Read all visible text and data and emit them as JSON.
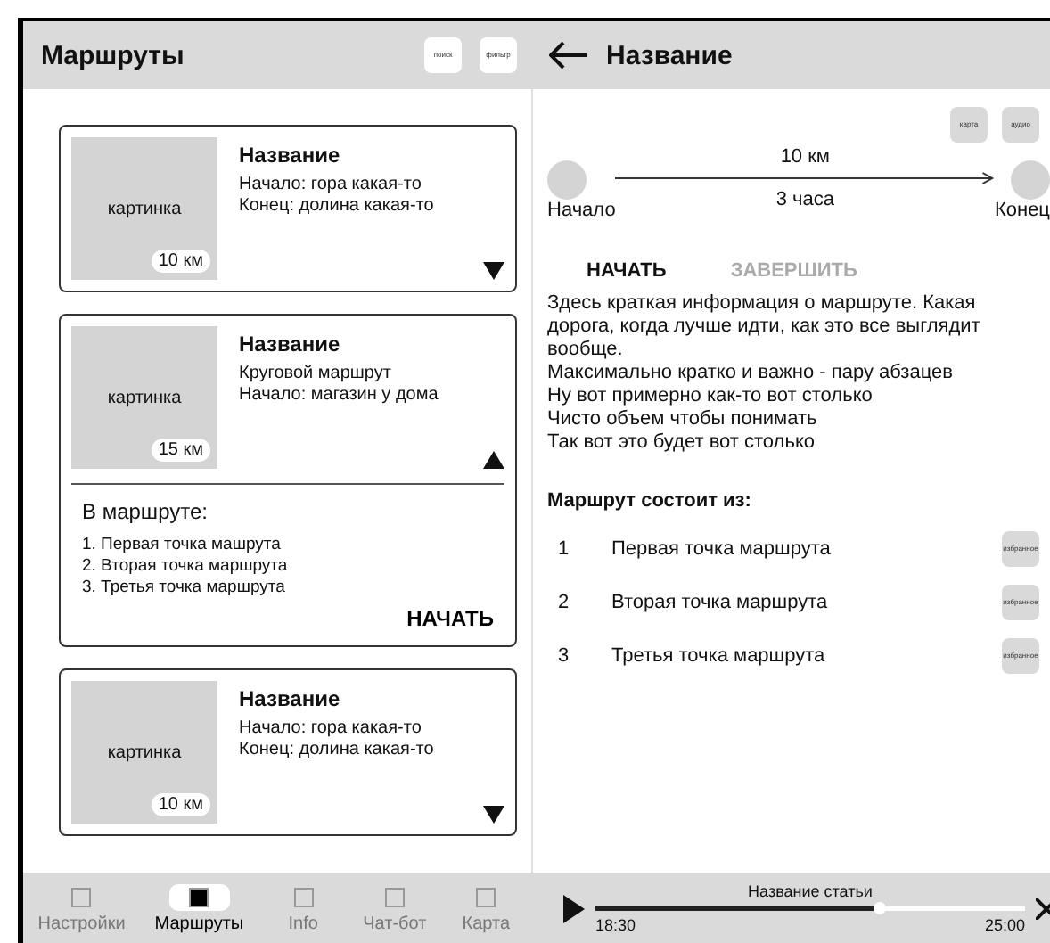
{
  "routes_screen": {
    "title": "Маршруты",
    "actions": [
      "поиск",
      "фильтр"
    ],
    "cards": [
      {
        "image_label": "картинка",
        "distance": "10 км",
        "name": "Название",
        "lines": [
          "Начало: гора какая-то",
          "Конец: долина какая-то"
        ],
        "expanded": false
      },
      {
        "image_label": "картинка",
        "distance": "15 км",
        "name": "Название",
        "lines": [
          "Круговой маршрут",
          "Начало: магазин у дома"
        ],
        "expanded": true,
        "details_title": "В маршруте:",
        "points": [
          "1. Первая точка машрута",
          "2. Вторая точка маршрута",
          "3. Третья точка маршрута"
        ],
        "start": "НАЧАТЬ"
      },
      {
        "image_label": "картинка",
        "distance": "10 км",
        "name": "Название",
        "lines": [
          "Начало: гора какая-то",
          "Конец: долина какая-то"
        ],
        "expanded": false
      }
    ],
    "nav": [
      {
        "label": "Настройки",
        "selected": false
      },
      {
        "label": "Маршруты",
        "selected": true
      },
      {
        "label": "Info",
        "selected": false
      },
      {
        "label": "Чат-бот",
        "selected": false
      },
      {
        "label": "Карта",
        "selected": false
      }
    ]
  },
  "detail_screen": {
    "title": "Название",
    "actions": [
      "карта",
      "аудио"
    ],
    "route": {
      "distance": "10 км",
      "duration": "3 часа",
      "start": "Начало",
      "end": "Конец"
    },
    "buttons": [
      {
        "label": "НАЧАТЬ",
        "disabled": false
      },
      {
        "label": "ЗАВЕРШИТЬ",
        "disabled": true
      }
    ],
    "description": [
      "Здесь краткая информация о маршруте. Какая дорога, когда лучше идти, как это все выглядит вообще.",
      "Максимально кратко и важно - пару абзацев",
      "Ну вот примерно как-то вот столько",
      "Чисто объем чтобы понимать",
      "Так вот это будет вот столько"
    ],
    "points_title": "Маршрут состоит из:",
    "points": [
      {
        "number": "1",
        "name": "Первая точка маршрута",
        "action": "избранное"
      },
      {
        "number": "2",
        "name": "Вторая точка маршрута",
        "action": "избранное"
      },
      {
        "number": "3",
        "name": "Третья точка маршрута",
        "action": "избранное"
      }
    ],
    "player": {
      "title": "Название статьи",
      "elapsed": "18:30",
      "total": "25:00",
      "level": 0.66
    }
  }
}
